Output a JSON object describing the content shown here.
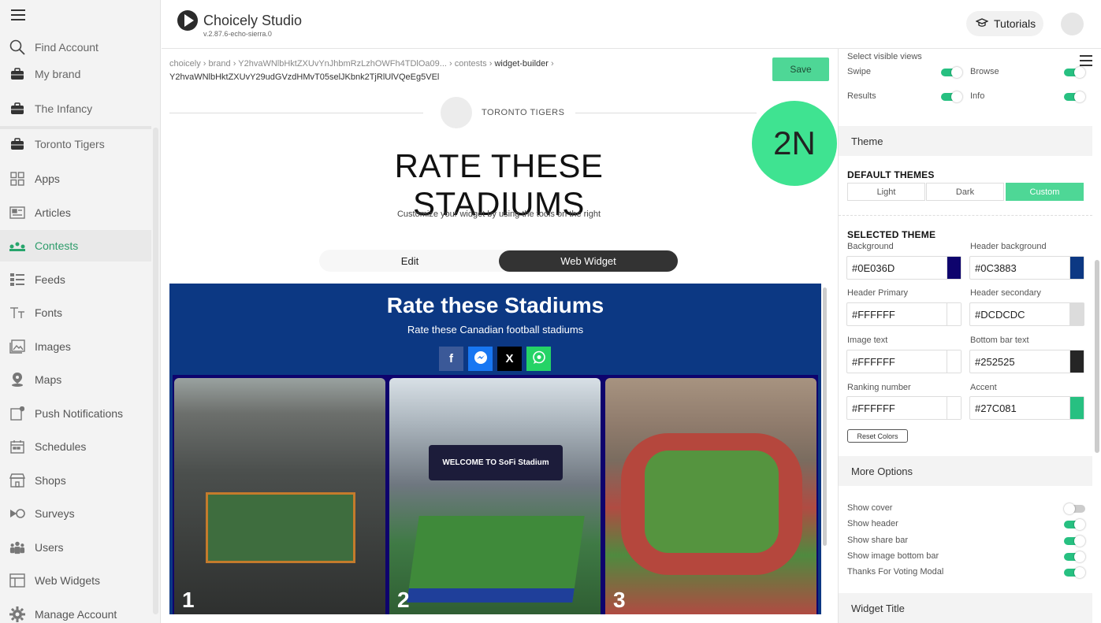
{
  "sidebar": {
    "items": [
      {
        "label": "Find Account",
        "icon": "search-icon"
      },
      {
        "label": "My brand",
        "icon": "briefcase-icon"
      },
      {
        "label": "The Infancy",
        "icon": "briefcase-icon"
      },
      {
        "label": "Toronto Tigers",
        "icon": "briefcase-icon"
      },
      {
        "label": "Apps",
        "icon": "apps-icon"
      },
      {
        "label": "Articles",
        "icon": "article-icon"
      },
      {
        "label": "Contests",
        "icon": "contest-icon"
      },
      {
        "label": "Feeds",
        "icon": "feed-icon"
      },
      {
        "label": "Fonts",
        "icon": "font-icon"
      },
      {
        "label": "Images",
        "icon": "image-icon"
      },
      {
        "label": "Maps",
        "icon": "map-pin-icon"
      },
      {
        "label": "Push Notifications",
        "icon": "notification-icon"
      },
      {
        "label": "Schedules",
        "icon": "calendar-icon"
      },
      {
        "label": "Shops",
        "icon": "shop-icon"
      },
      {
        "label": "Surveys",
        "icon": "survey-icon"
      },
      {
        "label": "Users",
        "icon": "users-icon"
      },
      {
        "label": "Web Widgets",
        "icon": "widget-icon"
      },
      {
        "label": "Manage Account",
        "icon": "gear-icon"
      }
    ],
    "active": "Contests"
  },
  "header": {
    "app_title": "Choicely Studio",
    "version": "v.2.87.6-echo-sierra.0",
    "tutorials_label": "Tutorials"
  },
  "breadcrumb": {
    "c1": "choicely",
    "c2": "brand",
    "c3": "Y2hvaWNlbHktZXUvYnJhbmRzLzhOWFh4TDlOa09...",
    "c4": "contests",
    "c5": "widget-builder",
    "line2": "Y2hvaWNlbHktZXUvY29udGVzdHMvT05selJKbnk2TjRlUlVQeEg5VEl"
  },
  "toolbar": {
    "save_label": "Save"
  },
  "preview": {
    "team_name": "TORONTO TIGERS",
    "title": "RATE THESE STADIUMS",
    "subtitle": "Customize your widget by using the tools on the right",
    "tab_edit": "Edit",
    "tab_web": "Web Widget",
    "badge": "2N"
  },
  "widget": {
    "title": "Rate these Stadiums",
    "subtitle": "Rate these Canadian football stadiums",
    "share": [
      {
        "label": "f",
        "name": "facebook-icon",
        "color": "#3b5998"
      },
      {
        "label": "m",
        "name": "messenger-icon",
        "color": "#1877f2"
      },
      {
        "label": "X",
        "name": "x-icon",
        "color": "#000000"
      },
      {
        "label": "w",
        "name": "whatsapp-icon",
        "color": "#25d366"
      }
    ],
    "cards": [
      {
        "num": "1"
      },
      {
        "num": "2",
        "screen_text": "WELCOME TO  SoFi Stadium"
      },
      {
        "num": "3"
      }
    ]
  },
  "panel": {
    "visible_views_label": "Select visible views",
    "views": [
      {
        "label": "Swipe",
        "on": true
      },
      {
        "label": "Browse",
        "on": true
      },
      {
        "label": "Results",
        "on": true
      },
      {
        "label": "Info",
        "on": true
      }
    ],
    "theme_section": "Theme",
    "default_themes_label": "DEFAULT THEMES",
    "theme_options": [
      "Light",
      "Dark",
      "Custom"
    ],
    "selected_theme_option": "Custom",
    "selected_theme_label": "SELECTED THEME",
    "colors": [
      {
        "label": "Background",
        "value": "#0E036D",
        "swatch": "#0E036D"
      },
      {
        "label": "Header background",
        "value": "#0C3883",
        "swatch": "#0C3883"
      },
      {
        "label": "Header Primary",
        "value": "#FFFFFF",
        "swatch": "#FFFFFF"
      },
      {
        "label": "Header secondary",
        "value": "#DCDCDC",
        "swatch": "#DCDCDC"
      },
      {
        "label": "Image text",
        "value": "#FFFFFF",
        "swatch": "#FFFFFF"
      },
      {
        "label": "Bottom bar text",
        "value": "#252525",
        "swatch": "#252525"
      },
      {
        "label": "Ranking number",
        "value": "#FFFFFF",
        "swatch": "#FFFFFF"
      },
      {
        "label": "Accent",
        "value": "#27C081",
        "swatch": "#27C081"
      }
    ],
    "reset_label": "Reset Colors",
    "more_options_section": "More Options",
    "options": [
      {
        "label": "Show cover",
        "on": false
      },
      {
        "label": "Show header",
        "on": true
      },
      {
        "label": "Show share bar",
        "on": true
      },
      {
        "label": "Show image bottom bar",
        "on": true
      },
      {
        "label": "Thanks For Voting Modal",
        "on": true
      }
    ],
    "widget_title_section": "Widget Title"
  }
}
